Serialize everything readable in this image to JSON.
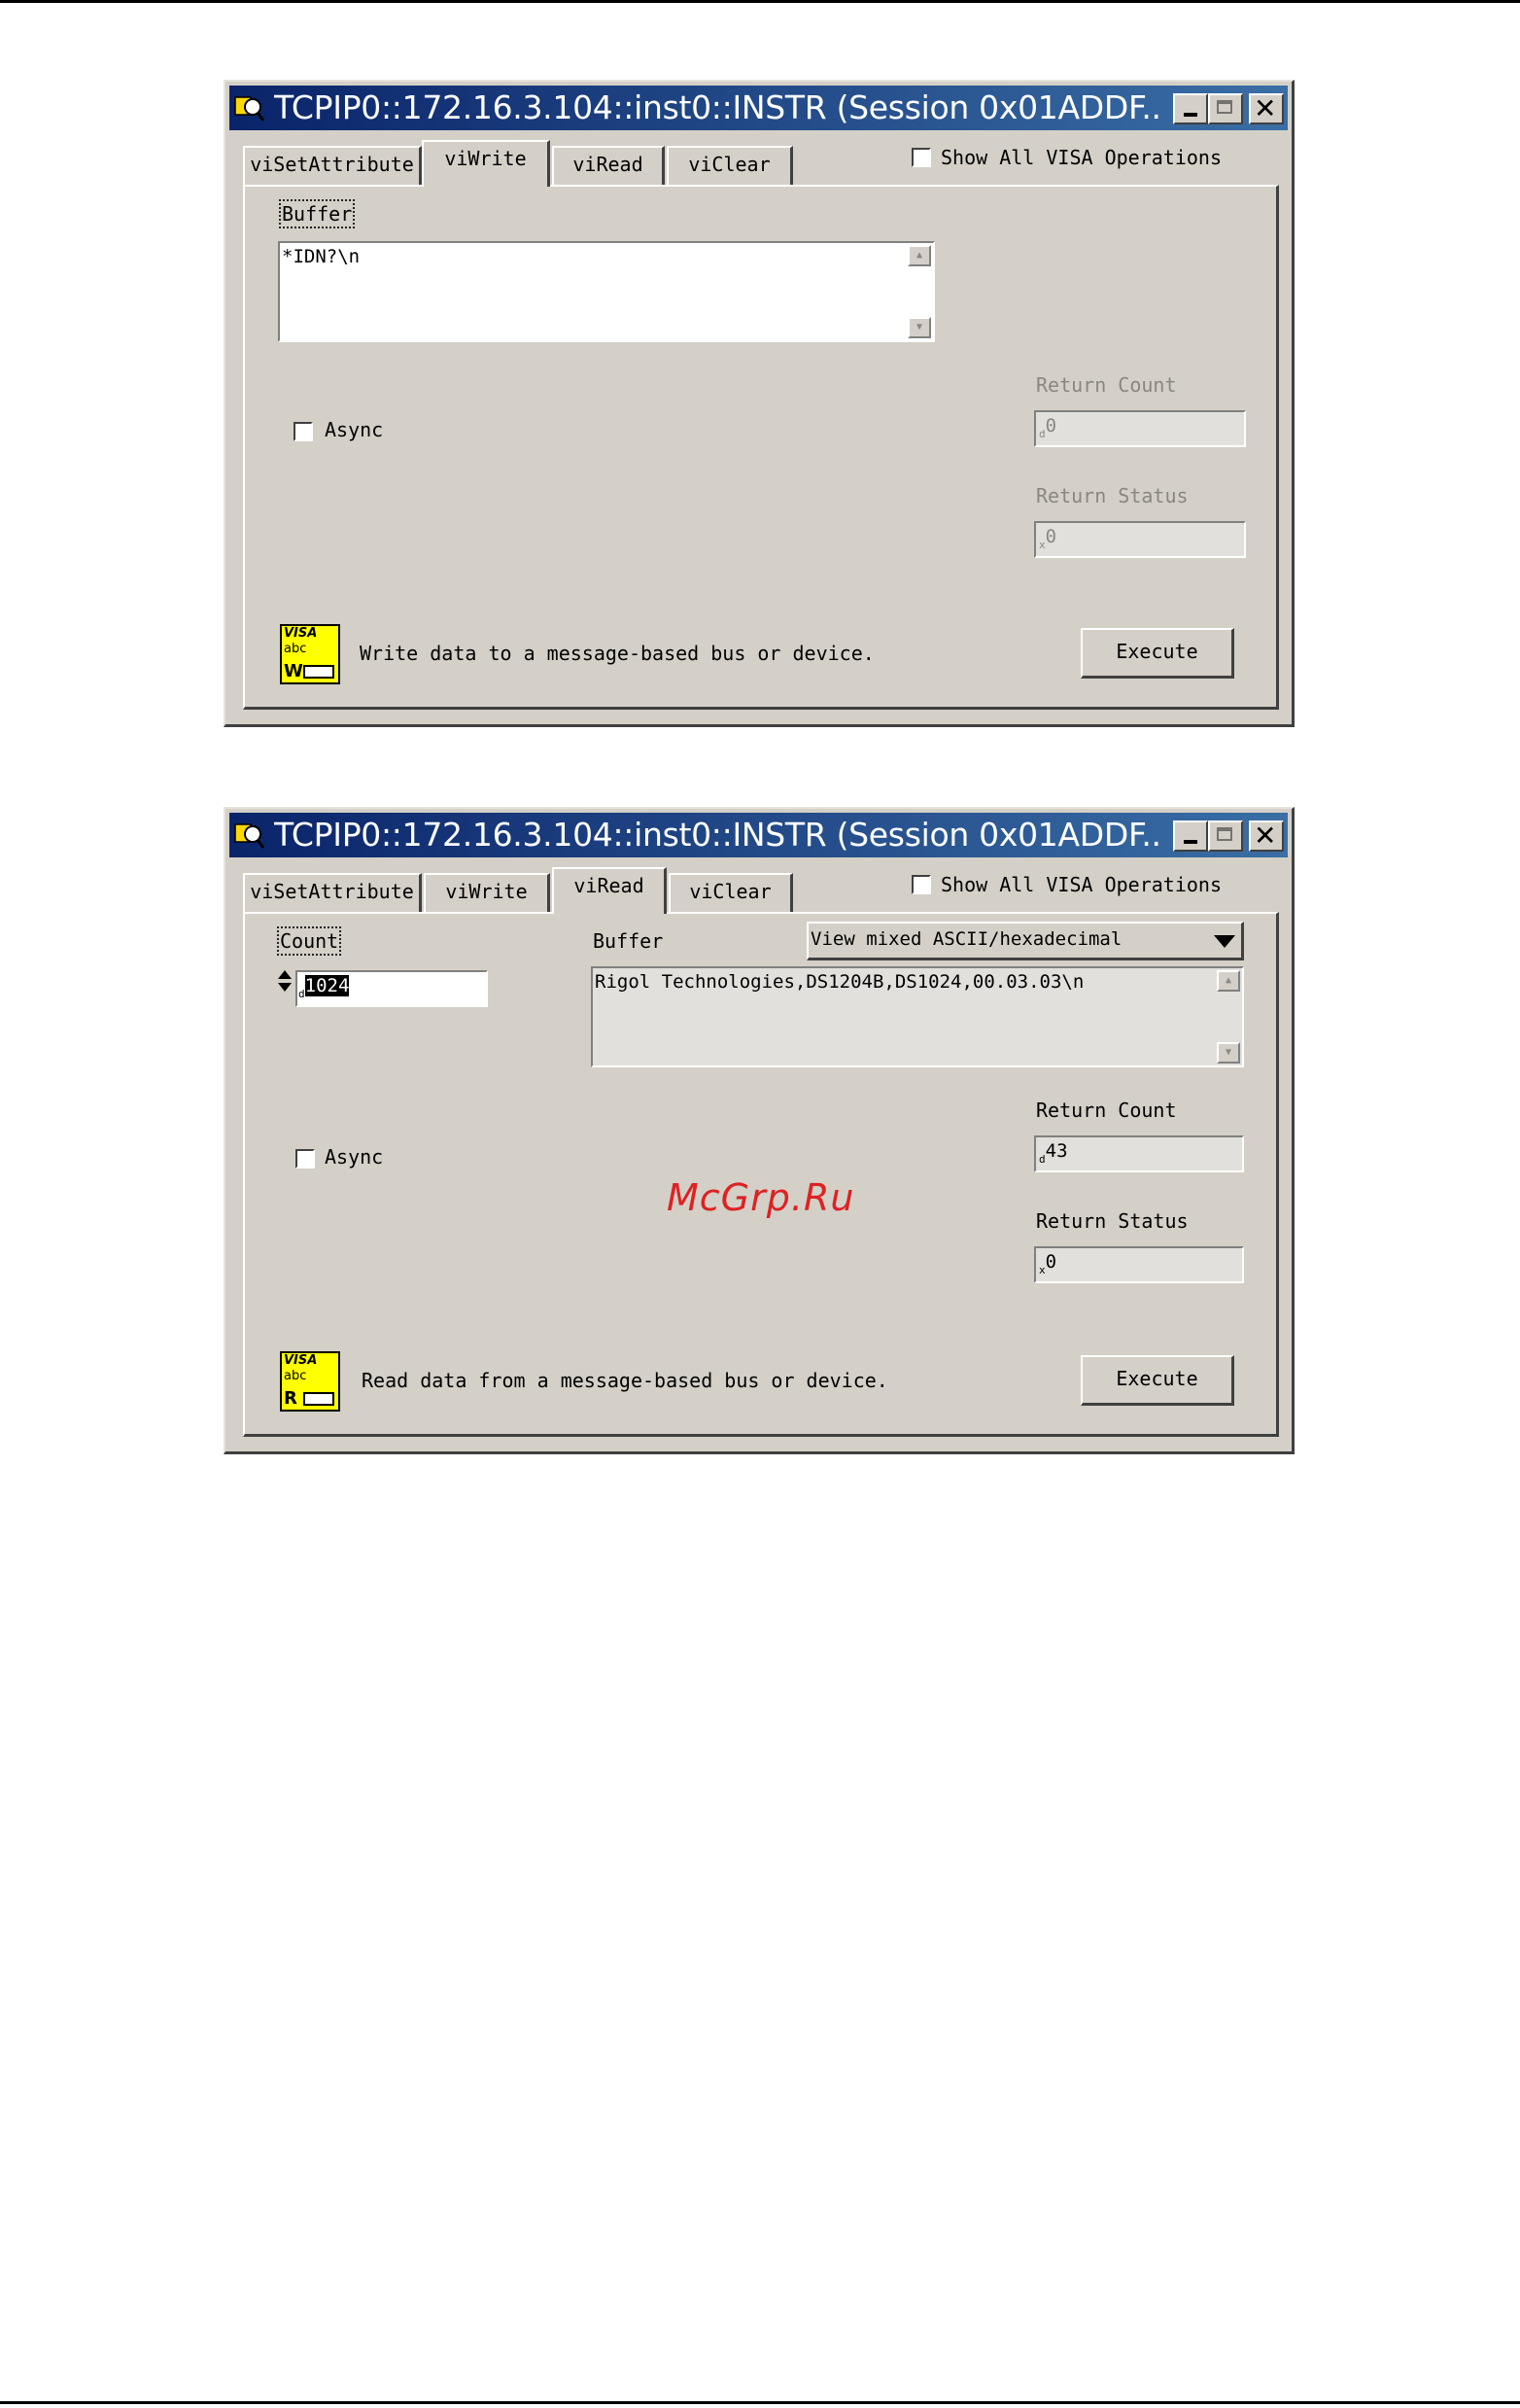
{
  "windows": [
    {
      "title": "TCPIP0::172.16.3.104::inst0::INSTR (Session 0x01ADDF...",
      "tabs": [
        "viSetAttribute",
        "viWrite",
        "viRead",
        "viClear"
      ],
      "selected_tab": "viWrite",
      "show_all_label": "Show All VISA Operations",
      "buffer_label": "Buffer",
      "buffer_value": "*IDN?\\n",
      "async_label": "Async",
      "return_count_label": "Return Count",
      "return_count_value": "0",
      "return_count_prefix": "d",
      "return_status_label": "Return Status",
      "return_status_value": "0",
      "return_status_prefix": "x",
      "icon_letter": "W",
      "icon_visa": "VISA",
      "icon_abc": "abc",
      "description": "Write data to a message-based bus or device.",
      "execute_label": "Execute"
    },
    {
      "title": "TCPIP0::172.16.3.104::inst0::INSTR (Session 0x01ADDF...",
      "tabs": [
        "viSetAttribute",
        "viWrite",
        "viRead",
        "viClear"
      ],
      "selected_tab": "viRead",
      "show_all_label": "Show All VISA Operations",
      "count_label": "Count",
      "count_value": "1024",
      "count_prefix": "d",
      "buffer_label": "Buffer",
      "view_mode": "View mixed ASCII/hexadecimal",
      "buffer_value": "Rigol Technologies,DS1204B,DS1024,00.03.03\\n",
      "async_label": "Async",
      "return_count_label": "Return Count",
      "return_count_value": "43",
      "return_count_prefix": "d",
      "return_status_label": "Return Status",
      "return_status_value": "0",
      "return_status_prefix": "x",
      "icon_letter": "R",
      "icon_visa": "VISA",
      "icon_abc": "abc",
      "description": "Read data from a message-based bus or device.",
      "execute_label": "Execute"
    }
  ],
  "watermark": "McGrp.Ru",
  "colors": {
    "titlebar_start": "#0a246a",
    "titlebar_end": "#3a6ea5",
    "face": "#d4d0c8",
    "icon_yellow": "#ffff00",
    "watermark": "#dd2222"
  }
}
